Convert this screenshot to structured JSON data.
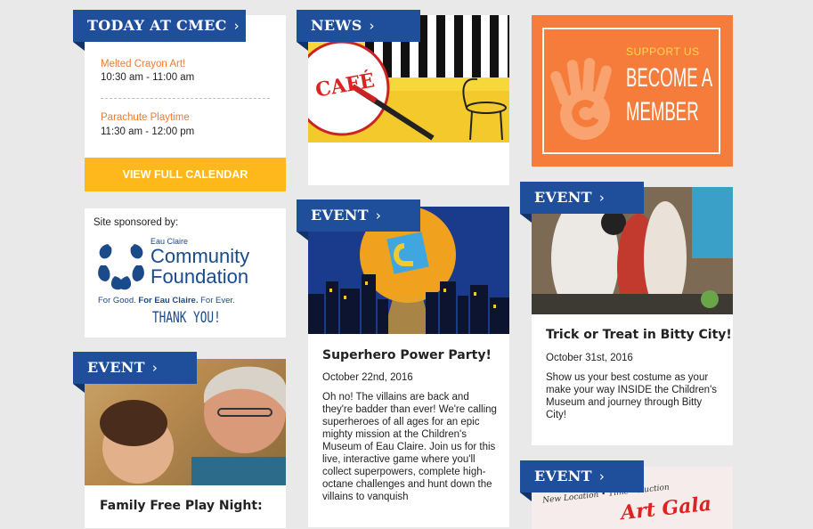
{
  "today": {
    "tab_label": "TODAY AT CMEC",
    "events": [
      {
        "name": "Melted Crayon Art!",
        "time": "10:30 am - 11:00 am"
      },
      {
        "name": "Parachute Playtime",
        "time": "11:30 am - 12:00 pm"
      }
    ],
    "calendar_button": "VIEW FULL CALENDAR"
  },
  "sponsor": {
    "label": "Site sponsored by:",
    "org_small": "Eau Claire",
    "org_line1": "Community",
    "org_line2": "Foundation",
    "tagline_a": "For Good. ",
    "tagline_b": "For Eau Claire.",
    "tagline_c": " For Ever.",
    "thanks": "THANK YOU!"
  },
  "news": {
    "tab_label": "NEWS",
    "cafe_text": "CAFÉ"
  },
  "event_superhero": {
    "tab_label": "EVENT",
    "title": "Superhero Power Party!",
    "date": "October 22nd, 2016",
    "body": "Oh no! The villains are back and they're badder than ever! We're calling superheroes of all ages for an epic mighty mission at the Children's Museum of Eau Claire. Join us for this live, interactive game where you'll collect superpowers, complete high-octane challenges and hunt down the villains to vanquish"
  },
  "event_family": {
    "tab_label": "EVENT",
    "title": "Family Free Play Night:"
  },
  "member": {
    "support": "SUPPORT US",
    "line1": "BECOME A",
    "line2": "MEMBER"
  },
  "event_trick": {
    "tab_label": "EVENT",
    "title": "Trick or Treat in Bitty City!",
    "date": "October 31st, 2016",
    "body": "Show us your best costume as your make your way INSIDE the Children's Museum and journey through Bitty City!"
  },
  "event_gala": {
    "tab_label": "EVENT",
    "script_small": "New Location • Time • Auction",
    "script_big": "Art Gala"
  },
  "colors": {
    "tab_blue": "#1f4f9b",
    "orange": "#f07a2e",
    "yellow_button": "#ffb81c"
  }
}
